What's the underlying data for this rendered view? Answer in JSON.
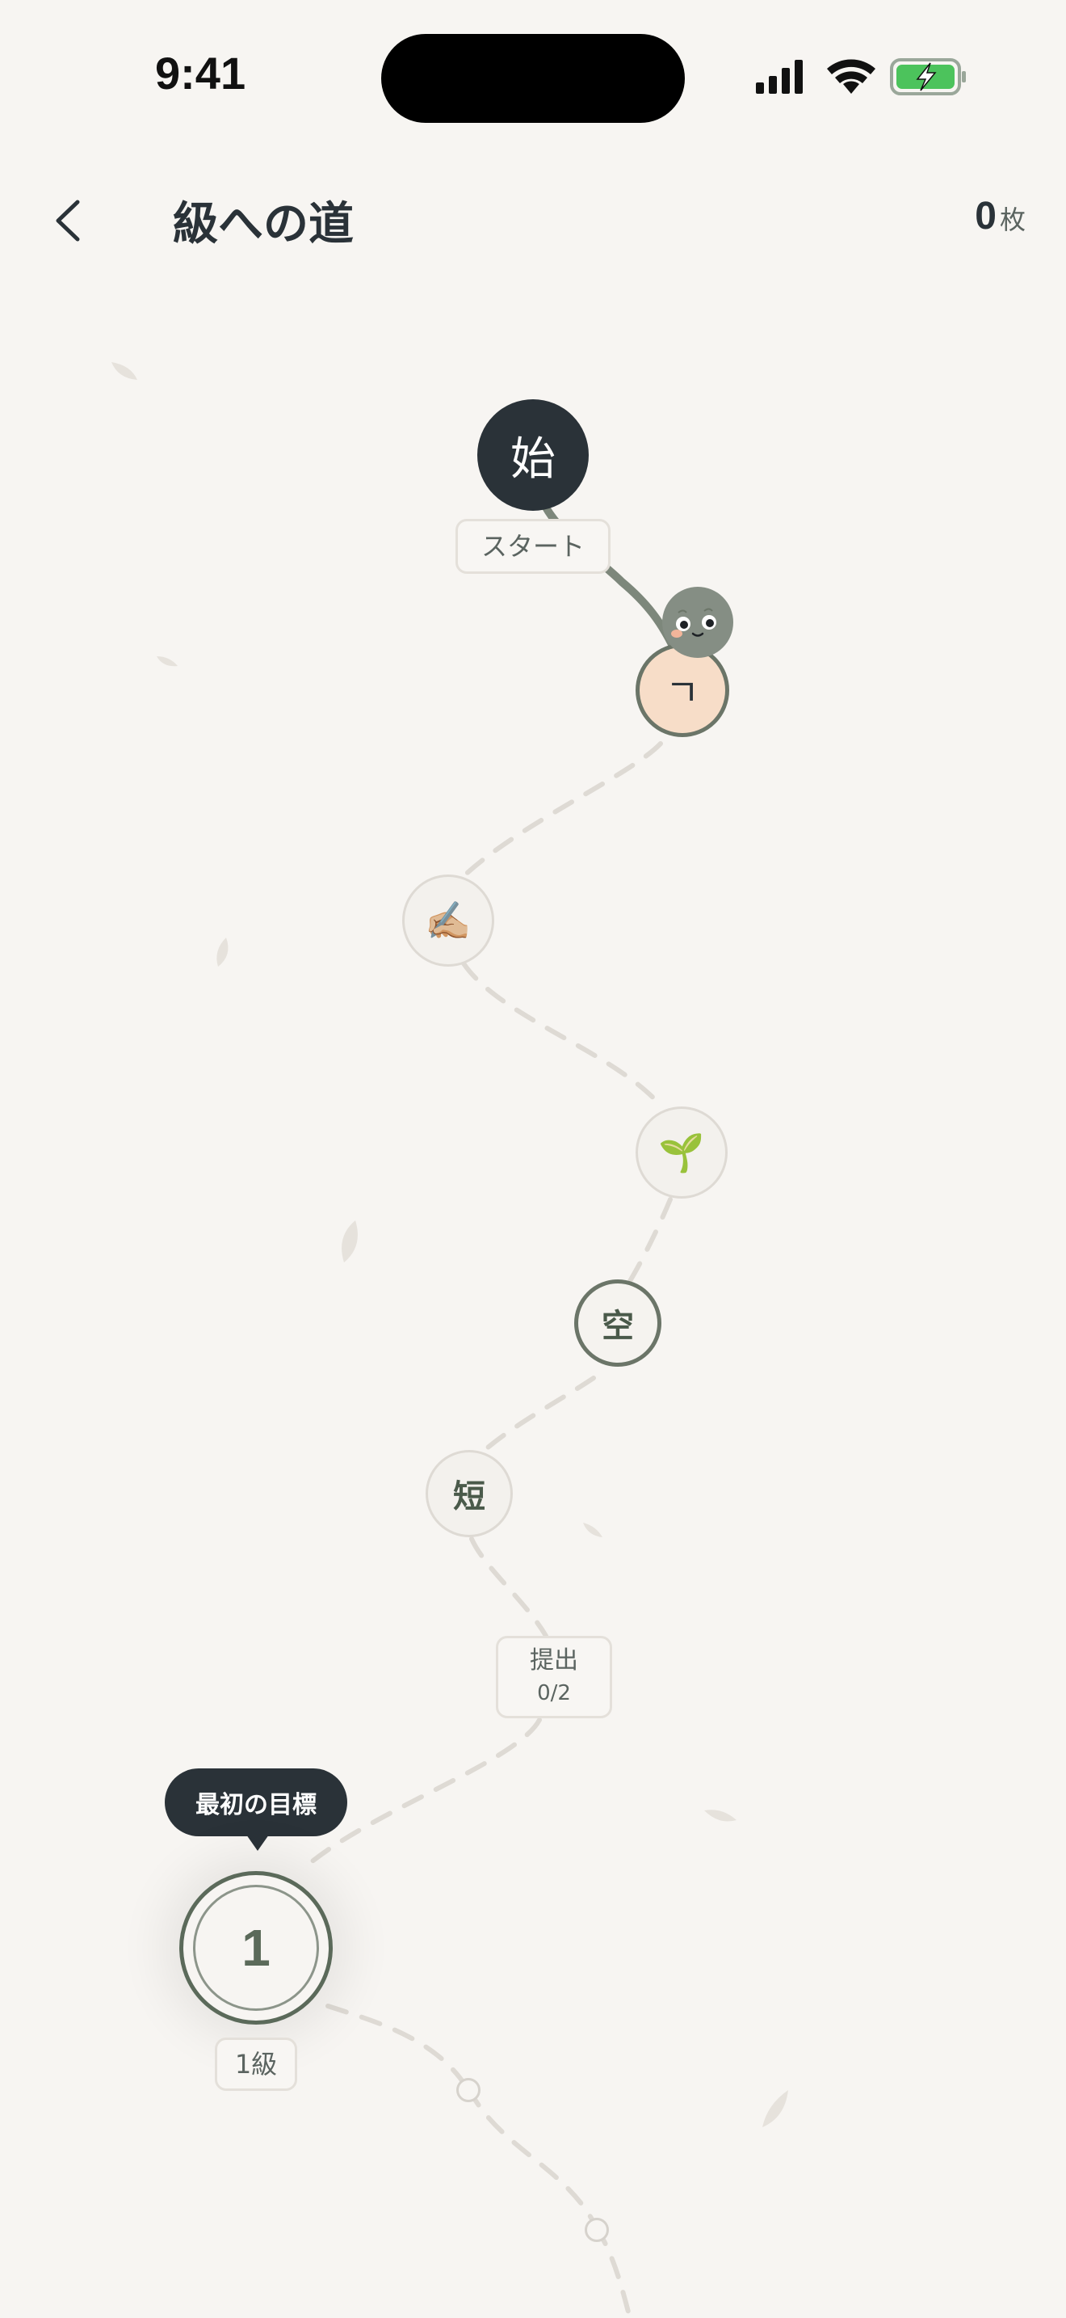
{
  "status": {
    "time": "9:41"
  },
  "header": {
    "title": "級への道",
    "coins_count": "0",
    "coins_unit": "枚"
  },
  "colors": {
    "background": "#f7f5f2",
    "dark": "#2a3238",
    "accent_green": "#6b7568",
    "current_fill": "#f7ddc8"
  },
  "map": {
    "start": {
      "kanji": "始",
      "label": "スタート"
    },
    "current": {
      "glyph": "ㄱ"
    },
    "writing_node": {
      "glyph": "✍🏼"
    },
    "sprout_node": {
      "glyph": "🌱"
    },
    "kanji_node_1": {
      "glyph": "空"
    },
    "kanji_node_2": {
      "glyph": "短"
    },
    "submit": {
      "label": "提出",
      "progress": "0/2"
    },
    "goal": {
      "tooltip": "最初の目標",
      "number": "1",
      "label": "1級"
    }
  }
}
